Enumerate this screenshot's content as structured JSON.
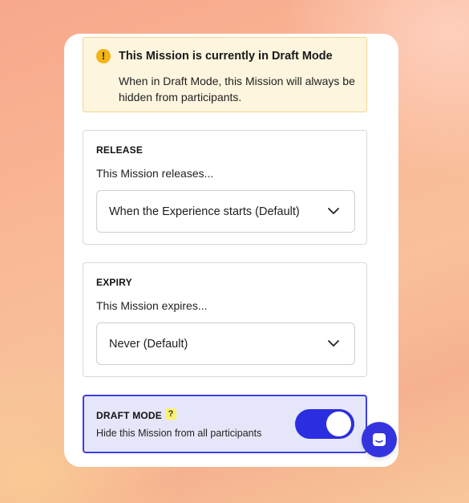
{
  "warning": {
    "icon": "exclamation-icon",
    "title": "This Mission is currently in Draft Mode",
    "body": "When in Draft Mode, this Mission will always be hidden from participants."
  },
  "release": {
    "label": "RELEASE",
    "description": "This Mission releases...",
    "selected": "When the Experience starts (Default)"
  },
  "expiry": {
    "label": "EXPIRY",
    "description": "This Mission expires...",
    "selected": "Never (Default)"
  },
  "draft_mode": {
    "label": "DRAFT MODE",
    "help": "?",
    "description": "Hide this Mission from all participants",
    "enabled": true
  },
  "chat": {
    "icon": "chat-icon"
  },
  "colors": {
    "accent": "#2b2ee0",
    "warning_bg": "#fdf5de",
    "warning_icon": "#f3b414",
    "draft_bg": "#e6e6fb"
  }
}
